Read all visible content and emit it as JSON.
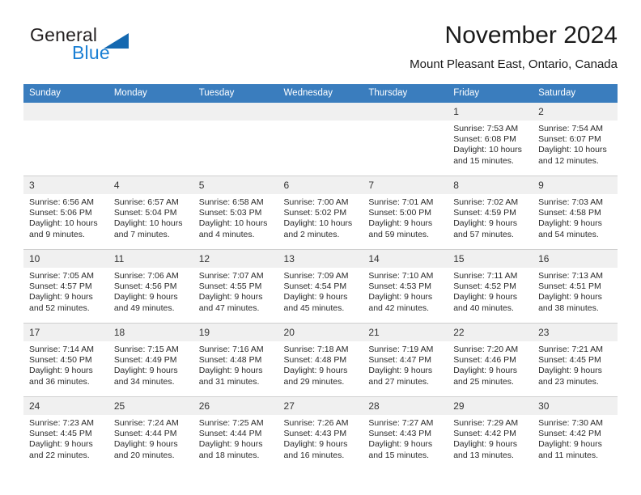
{
  "brand": {
    "word1": "General",
    "word2": "Blue",
    "triangle_color": "#1468b0",
    "blue_color": "#1a7fd4"
  },
  "header": {
    "title": "November 2024",
    "subtitle": "Mount Pleasant East, Ontario, Canada"
  },
  "theme": {
    "header_row_bg": "#3a7dbe",
    "daynum_bg": "#f0f0f0",
    "grid_line": "#cfcfcf",
    "text": "#2b2b2b"
  },
  "calendar": {
    "weekday_headers": [
      "Sunday",
      "Monday",
      "Tuesday",
      "Wednesday",
      "Thursday",
      "Friday",
      "Saturday"
    ],
    "labels": {
      "sunrise": "Sunrise:",
      "sunset": "Sunset:",
      "daylight": "Daylight:"
    },
    "weeks": [
      [
        {
          "blank": true
        },
        {
          "blank": true
        },
        {
          "blank": true
        },
        {
          "blank": true
        },
        {
          "blank": true
        },
        {
          "day": "1",
          "sunrise": "Sunrise: 7:53 AM",
          "sunset": "Sunset: 6:08 PM",
          "daylight1": "Daylight: 10 hours",
          "daylight2": "and 15 minutes."
        },
        {
          "day": "2",
          "sunrise": "Sunrise: 7:54 AM",
          "sunset": "Sunset: 6:07 PM",
          "daylight1": "Daylight: 10 hours",
          "daylight2": "and 12 minutes."
        }
      ],
      [
        {
          "day": "3",
          "sunrise": "Sunrise: 6:56 AM",
          "sunset": "Sunset: 5:06 PM",
          "daylight1": "Daylight: 10 hours",
          "daylight2": "and 9 minutes."
        },
        {
          "day": "4",
          "sunrise": "Sunrise: 6:57 AM",
          "sunset": "Sunset: 5:04 PM",
          "daylight1": "Daylight: 10 hours",
          "daylight2": "and 7 minutes."
        },
        {
          "day": "5",
          "sunrise": "Sunrise: 6:58 AM",
          "sunset": "Sunset: 5:03 PM",
          "daylight1": "Daylight: 10 hours",
          "daylight2": "and 4 minutes."
        },
        {
          "day": "6",
          "sunrise": "Sunrise: 7:00 AM",
          "sunset": "Sunset: 5:02 PM",
          "daylight1": "Daylight: 10 hours",
          "daylight2": "and 2 minutes."
        },
        {
          "day": "7",
          "sunrise": "Sunrise: 7:01 AM",
          "sunset": "Sunset: 5:00 PM",
          "daylight1": "Daylight: 9 hours",
          "daylight2": "and 59 minutes."
        },
        {
          "day": "8",
          "sunrise": "Sunrise: 7:02 AM",
          "sunset": "Sunset: 4:59 PM",
          "daylight1": "Daylight: 9 hours",
          "daylight2": "and 57 minutes."
        },
        {
          "day": "9",
          "sunrise": "Sunrise: 7:03 AM",
          "sunset": "Sunset: 4:58 PM",
          "daylight1": "Daylight: 9 hours",
          "daylight2": "and 54 minutes."
        }
      ],
      [
        {
          "day": "10",
          "sunrise": "Sunrise: 7:05 AM",
          "sunset": "Sunset: 4:57 PM",
          "daylight1": "Daylight: 9 hours",
          "daylight2": "and 52 minutes."
        },
        {
          "day": "11",
          "sunrise": "Sunrise: 7:06 AM",
          "sunset": "Sunset: 4:56 PM",
          "daylight1": "Daylight: 9 hours",
          "daylight2": "and 49 minutes."
        },
        {
          "day": "12",
          "sunrise": "Sunrise: 7:07 AM",
          "sunset": "Sunset: 4:55 PM",
          "daylight1": "Daylight: 9 hours",
          "daylight2": "and 47 minutes."
        },
        {
          "day": "13",
          "sunrise": "Sunrise: 7:09 AM",
          "sunset": "Sunset: 4:54 PM",
          "daylight1": "Daylight: 9 hours",
          "daylight2": "and 45 minutes."
        },
        {
          "day": "14",
          "sunrise": "Sunrise: 7:10 AM",
          "sunset": "Sunset: 4:53 PM",
          "daylight1": "Daylight: 9 hours",
          "daylight2": "and 42 minutes."
        },
        {
          "day": "15",
          "sunrise": "Sunrise: 7:11 AM",
          "sunset": "Sunset: 4:52 PM",
          "daylight1": "Daylight: 9 hours",
          "daylight2": "and 40 minutes."
        },
        {
          "day": "16",
          "sunrise": "Sunrise: 7:13 AM",
          "sunset": "Sunset: 4:51 PM",
          "daylight1": "Daylight: 9 hours",
          "daylight2": "and 38 minutes."
        }
      ],
      [
        {
          "day": "17",
          "sunrise": "Sunrise: 7:14 AM",
          "sunset": "Sunset: 4:50 PM",
          "daylight1": "Daylight: 9 hours",
          "daylight2": "and 36 minutes."
        },
        {
          "day": "18",
          "sunrise": "Sunrise: 7:15 AM",
          "sunset": "Sunset: 4:49 PM",
          "daylight1": "Daylight: 9 hours",
          "daylight2": "and 34 minutes."
        },
        {
          "day": "19",
          "sunrise": "Sunrise: 7:16 AM",
          "sunset": "Sunset: 4:48 PM",
          "daylight1": "Daylight: 9 hours",
          "daylight2": "and 31 minutes."
        },
        {
          "day": "20",
          "sunrise": "Sunrise: 7:18 AM",
          "sunset": "Sunset: 4:48 PM",
          "daylight1": "Daylight: 9 hours",
          "daylight2": "and 29 minutes."
        },
        {
          "day": "21",
          "sunrise": "Sunrise: 7:19 AM",
          "sunset": "Sunset: 4:47 PM",
          "daylight1": "Daylight: 9 hours",
          "daylight2": "and 27 minutes."
        },
        {
          "day": "22",
          "sunrise": "Sunrise: 7:20 AM",
          "sunset": "Sunset: 4:46 PM",
          "daylight1": "Daylight: 9 hours",
          "daylight2": "and 25 minutes."
        },
        {
          "day": "23",
          "sunrise": "Sunrise: 7:21 AM",
          "sunset": "Sunset: 4:45 PM",
          "daylight1": "Daylight: 9 hours",
          "daylight2": "and 23 minutes."
        }
      ],
      [
        {
          "day": "24",
          "sunrise": "Sunrise: 7:23 AM",
          "sunset": "Sunset: 4:45 PM",
          "daylight1": "Daylight: 9 hours",
          "daylight2": "and 22 minutes."
        },
        {
          "day": "25",
          "sunrise": "Sunrise: 7:24 AM",
          "sunset": "Sunset: 4:44 PM",
          "daylight1": "Daylight: 9 hours",
          "daylight2": "and 20 minutes."
        },
        {
          "day": "26",
          "sunrise": "Sunrise: 7:25 AM",
          "sunset": "Sunset: 4:44 PM",
          "daylight1": "Daylight: 9 hours",
          "daylight2": "and 18 minutes."
        },
        {
          "day": "27",
          "sunrise": "Sunrise: 7:26 AM",
          "sunset": "Sunset: 4:43 PM",
          "daylight1": "Daylight: 9 hours",
          "daylight2": "and 16 minutes."
        },
        {
          "day": "28",
          "sunrise": "Sunrise: 7:27 AM",
          "sunset": "Sunset: 4:43 PM",
          "daylight1": "Daylight: 9 hours",
          "daylight2": "and 15 minutes."
        },
        {
          "day": "29",
          "sunrise": "Sunrise: 7:29 AM",
          "sunset": "Sunset: 4:42 PM",
          "daylight1": "Daylight: 9 hours",
          "daylight2": "and 13 minutes."
        },
        {
          "day": "30",
          "sunrise": "Sunrise: 7:30 AM",
          "sunset": "Sunset: 4:42 PM",
          "daylight1": "Daylight: 9 hours",
          "daylight2": "and 11 minutes."
        }
      ]
    ]
  }
}
